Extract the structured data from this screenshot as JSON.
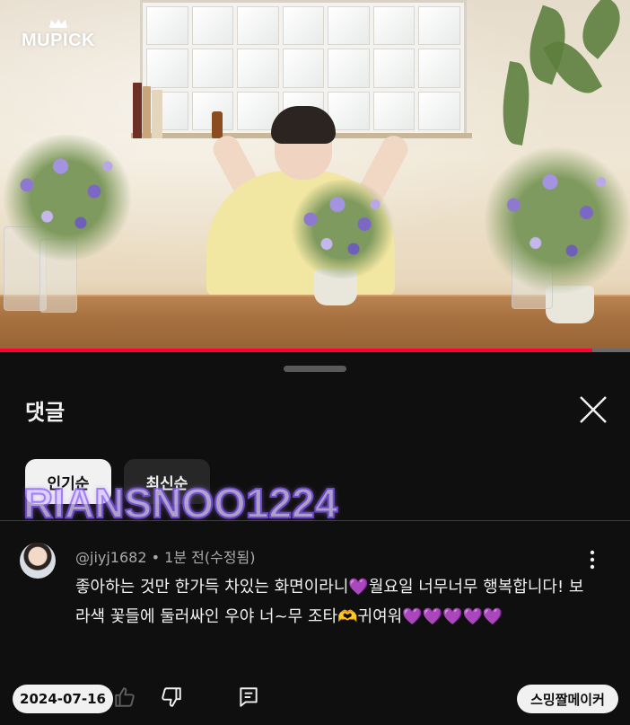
{
  "video": {
    "channel_logo": "MUPICK",
    "progress_fraction": 0.94,
    "progress_color": "#ff0033"
  },
  "comments_panel": {
    "title": "댓글",
    "close_icon": "close-icon",
    "sort_chips": [
      {
        "label": "인기순",
        "selected": true
      },
      {
        "label": "최신순",
        "selected": false
      }
    ]
  },
  "overlay": {
    "watermark_text": "RIANSNOO1224"
  },
  "comment": {
    "author": "@jiyj1682",
    "separator": "•",
    "time": "1분 전(수정됨)",
    "text_part1": "좋아하는 것만 한가득 차있는 화면이라니",
    "heart1": "💜",
    "text_part2": "월요일 너무너무 행복합니다! 보라색 꽃들에 둘러싸인 우야 너~무 조타",
    "hands": "🫶",
    "text_part3": "귀여워",
    "hearts_end": "💜💜💜💜💜",
    "actions": {
      "like_icon": "thumbs-up-icon",
      "dislike_icon": "thumbs-down-icon",
      "reply_icon": "reply-icon",
      "more_icon": "more-vert-icon"
    }
  },
  "bottom_overlay": {
    "date_label": "2024-07-16",
    "brand_label": "스밍짤메이커"
  }
}
